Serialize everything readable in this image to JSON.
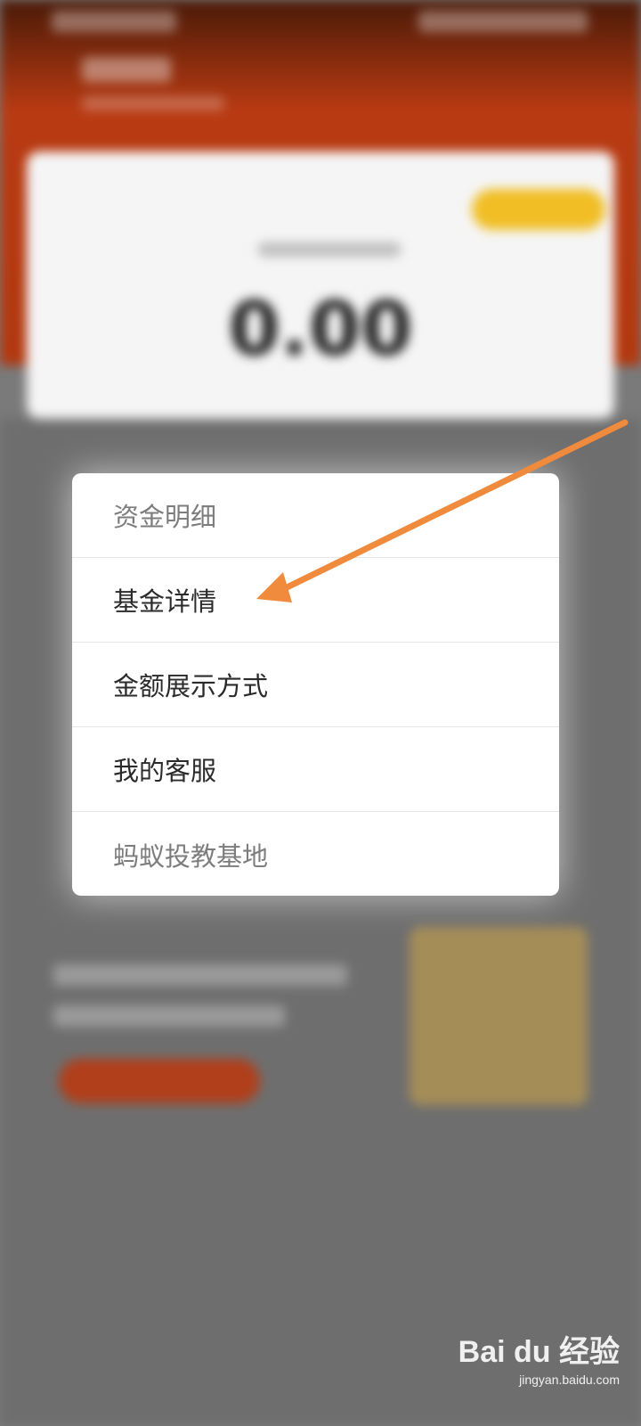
{
  "background": {
    "balance_value": "0.00"
  },
  "menu": {
    "items": [
      {
        "label": "资金明细"
      },
      {
        "label": "基金详情"
      },
      {
        "label": "金额展示方式"
      },
      {
        "label": "我的客服"
      },
      {
        "label": "蚂蚁投教基地"
      }
    ]
  },
  "watermark": {
    "brand": "Bai du 经验",
    "url": "jingyan.baidu.com"
  },
  "colors": {
    "header": "#b2380f",
    "arrow": "#f08a3c",
    "menu_bg": "#ffffff"
  }
}
